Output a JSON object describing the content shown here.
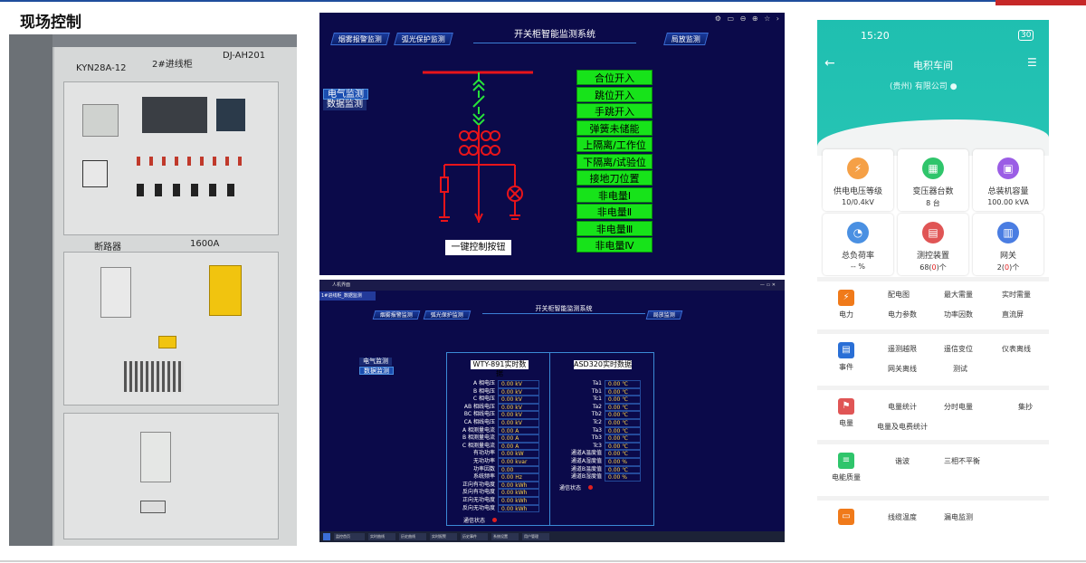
{
  "slide": {
    "title": "现场控制"
  },
  "photo": {
    "cabinet_model": "KYN28A-12",
    "cabinet_name": "2#进线柜",
    "cabinet_code": "DJ-AH201",
    "breaker_label": "断路器",
    "breaker_rating": "1600A"
  },
  "scada_top": {
    "system_title": "开关柜智能监测系统",
    "tabs": [
      "烟雾报警监测",
      "弧光保护监测",
      "局放监测"
    ],
    "nav": [
      "电气监测",
      "数据监测"
    ],
    "status_buttons": [
      "合位开入",
      "跳位开入",
      "手跳开入",
      "弹簧未储能",
      "上隔离/工作位",
      "下隔离/试验位",
      "接地刀位置",
      "非电量Ⅰ",
      "非电量Ⅱ",
      "非电量Ⅲ",
      "非电量Ⅳ"
    ],
    "one_key_button": "一键控制按钮",
    "colors": {
      "bg": "#0b0a4a",
      "busbar": "#e8141a",
      "status_on": "#17e31a",
      "breaker": "#27e33a"
    }
  },
  "scada_bottom": {
    "window_title": "人机界面",
    "system_title": "开关柜智能监测系统",
    "tabs": [
      "烟雾报警监测",
      "弧光保护监测",
      "局放监测"
    ],
    "nav": [
      "电气监测",
      "数据监测"
    ],
    "device_tab": "1#进线柜_数据监测",
    "wty": {
      "title": "WTY-891实时数据",
      "rows": [
        {
          "k": "A 相电压",
          "v": "0.00 kV"
        },
        {
          "k": "B 相电压",
          "v": "0.00 kV"
        },
        {
          "k": "C 相电压",
          "v": "0.00 kV"
        },
        {
          "k": "AB 相线电压",
          "v": "0.00 kV"
        },
        {
          "k": "BC 相线电压",
          "v": "0.00 kV"
        },
        {
          "k": "CA 相线电压",
          "v": "0.00 kV"
        },
        {
          "k": "A 相测量电流",
          "v": "0.00 A"
        },
        {
          "k": "B 相测量电流",
          "v": "0.00 A"
        },
        {
          "k": "C 相测量电流",
          "v": "0.00 A"
        },
        {
          "k": "有功功率",
          "v": "0.00 kW"
        },
        {
          "k": "无功功率",
          "v": "0.00 kvar"
        },
        {
          "k": "功率因数",
          "v": "0.00"
        },
        {
          "k": "系统频率",
          "v": "0.00 Hz"
        },
        {
          "k": "正向有功电度",
          "v": "0.00 kWh"
        },
        {
          "k": "反向有功电度",
          "v": "0.00 kWh"
        },
        {
          "k": "正向无功电度",
          "v": "0.00 kWh"
        },
        {
          "k": "反向无功电度",
          "v": "0.00 kWh"
        }
      ],
      "comm_label": "通信状态"
    },
    "asd": {
      "title": "ASD320实时数据",
      "rows": [
        {
          "k": "Ta1",
          "v": "0.00 ℃"
        },
        {
          "k": "Tb1",
          "v": "0.00 ℃"
        },
        {
          "k": "Tc1",
          "v": "0.00 ℃"
        },
        {
          "k": "Ta2",
          "v": "0.00 ℃"
        },
        {
          "k": "Tb2",
          "v": "0.00 ℃"
        },
        {
          "k": "Tc2",
          "v": "0.00 ℃"
        },
        {
          "k": "Ta3",
          "v": "0.00 ℃"
        },
        {
          "k": "Tb3",
          "v": "0.00 ℃"
        },
        {
          "k": "Tc3",
          "v": "0.00 ℃"
        },
        {
          "k": "通道A温度值",
          "v": "0.00 ℃"
        },
        {
          "k": "通道A湿度值",
          "v": "0.00 %"
        },
        {
          "k": "通道B温度值",
          "v": "0.00 ℃"
        },
        {
          "k": "通道B湿度值",
          "v": "0.00 %"
        }
      ],
      "comm_label": "通信状态"
    },
    "taskbar": [
      "监控首页",
      "实时曲线",
      "历史曲线",
      "实时报警",
      "历史事件",
      "系统设置",
      "用户管理"
    ]
  },
  "phone": {
    "time": "15:20",
    "status_right": "30",
    "title": "电积车间",
    "company": "(贵州) 有限公司",
    "cards": [
      {
        "name": "供电电压等级",
        "value": "10/0.4kV",
        "icon": "lightning-icon",
        "color": "#f5a046"
      },
      {
        "name": "变压器台数",
        "value": "8 台",
        "icon": "transformer-icon",
        "color": "#2fc56b"
      },
      {
        "name": "总装机容量",
        "value": "100.00 kVA",
        "icon": "capacity-icon",
        "color": "#9b5de5"
      },
      {
        "name": "总负荷率",
        "value": "-- %",
        "icon": "load-icon",
        "color": "#4a90e2"
      },
      {
        "name": "测控装置",
        "value_pre": "68(",
        "value_red": "0",
        "value_post": ")个",
        "icon": "device-icon",
        "color": "#e05555"
      },
      {
        "name": "网关",
        "value_pre": "2(",
        "value_red": "0",
        "value_post": ")个",
        "icon": "gateway-icon",
        "color": "#4a7de2"
      }
    ],
    "sections": [
      {
        "label": "电力",
        "icon": "power-icon",
        "color": "#f07a1a",
        "items": [
          "配电图",
          "最大需量",
          "实时需量",
          "电力参数",
          "功率因数",
          "直流屏"
        ]
      },
      {
        "label": "事件",
        "icon": "event-icon",
        "color": "#2a6fd6",
        "items": [
          "遥测越限",
          "遥信变位",
          "仪表离线",
          "网关离线",
          "测试"
        ]
      },
      {
        "label": "电量",
        "icon": "energy-icon",
        "color": "#e05555",
        "items": [
          "电量统计",
          "分时电量",
          "集抄",
          "电量及电费统计"
        ]
      },
      {
        "label": "电能质量",
        "icon": "quality-icon",
        "color": "#2fc56b",
        "items": [
          "谐波",
          "三相不平衡"
        ]
      },
      {
        "label": "",
        "icon": "monitor-icon",
        "color": "#f07a1a",
        "items": [
          "线缆温度",
          "漏电监测"
        ]
      }
    ]
  }
}
